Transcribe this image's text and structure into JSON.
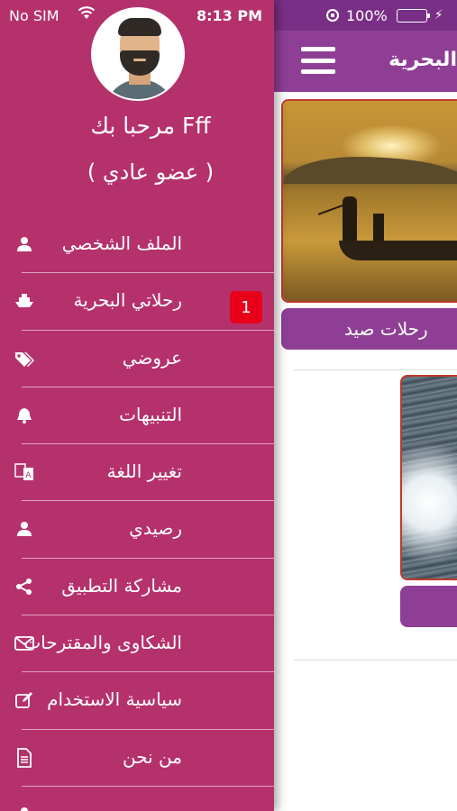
{
  "status_bar": {
    "carrier": "No SIM",
    "time": "8:13 PM",
    "battery": "100%",
    "battery_level": 1.0,
    "battery_color": "#4cd964"
  },
  "header": {
    "title": "البحرية",
    "menu_icon": "hamburger-icon"
  },
  "trips": {
    "card1_button": "رحلات صيد"
  },
  "drawer": {
    "greeting": "مرحبا بك Fff",
    "member_type": "( عضو عادي )",
    "items": [
      {
        "label": "الملف الشخصي",
        "icon": "user-icon"
      },
      {
        "label": "رحلاتي البحرية",
        "icon": "ship-icon",
        "badge": "1"
      },
      {
        "label": "عروضي",
        "icon": "tags-icon"
      },
      {
        "label": "التنبيهات",
        "icon": "bell-icon"
      },
      {
        "label": "تغيير اللغة",
        "icon": "language-icon"
      },
      {
        "label": "رصيدي",
        "icon": "user-icon"
      },
      {
        "label": "مشاركة التطبيق",
        "icon": "share-icon"
      },
      {
        "label": "الشكاوى والمقترحات",
        "icon": "envelope-icon"
      },
      {
        "label": "سياسية الاستخدام",
        "icon": "edit-icon"
      },
      {
        "label": "من نحن",
        "icon": "document-icon"
      }
    ]
  },
  "colors": {
    "drawer_bg": "#b5316c",
    "header_bg": "#8e3f95",
    "badge": "#e8001b"
  }
}
